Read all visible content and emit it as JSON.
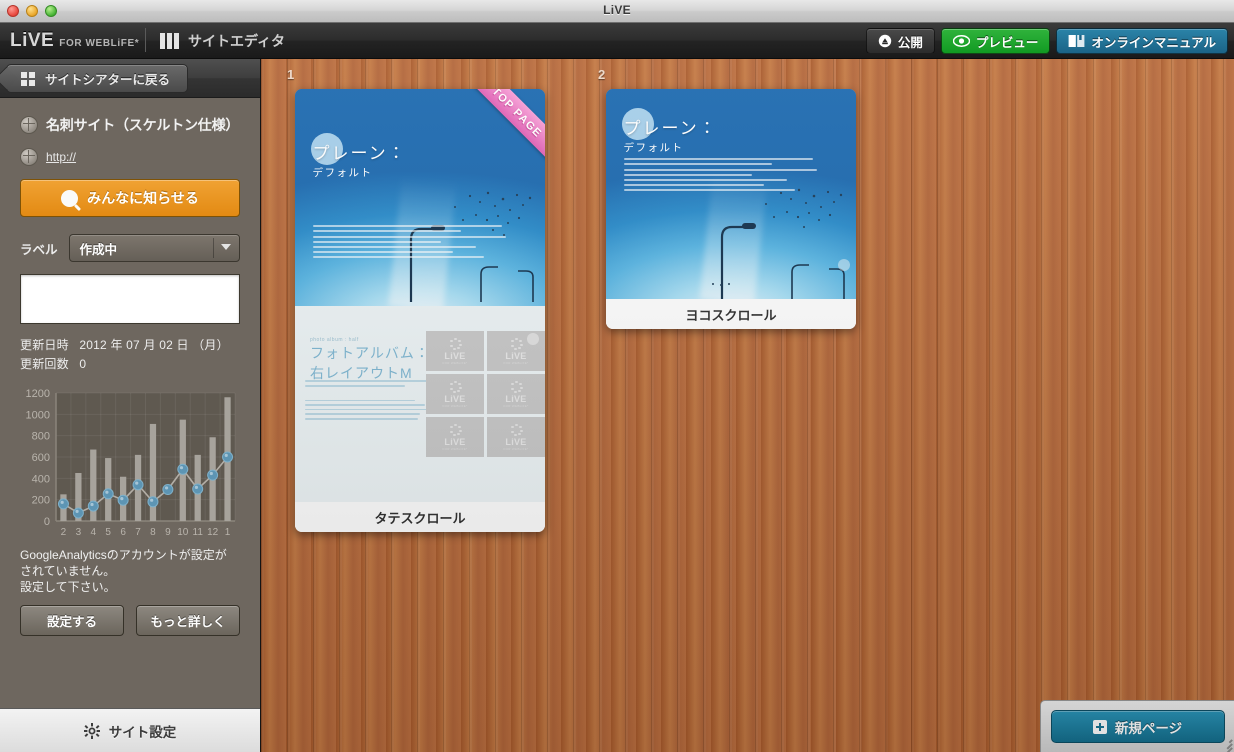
{
  "window": {
    "title": "LiVE"
  },
  "appbar": {
    "brand_live": "LiVE",
    "brand_for_weblife": "FOR WEBLiFE*",
    "section_title": "サイトエディタ",
    "buttons": {
      "publish": "公開",
      "preview": "プレビュー",
      "manual": "オンラインマニュアル"
    }
  },
  "sidebar": {
    "back_button": "サイトシアターに戻る",
    "site_name": "名刺サイト（スケルトン仕様）",
    "site_url": "http://",
    "share_button": "みんなに知らせる",
    "label_caption": "ラベル",
    "label_value": "作成中",
    "memo_value": "",
    "updated_at_label": "更新日時",
    "updated_at_value": "2012 年 07 月 02 日 （月）",
    "update_count_label": "更新回数",
    "update_count_value": "0",
    "ga_notice_line1": "GoogleAnalyticsのアカウントが設定が",
    "ga_notice_line2": "されていません。",
    "ga_notice_line3": "設定して下さい。",
    "ga_configure_button": "設定する",
    "ga_more_button": "もっと詳しく",
    "site_settings_button": "サイト設定"
  },
  "chart_data": {
    "type": "bar",
    "title": "",
    "xlabel": "",
    "ylabel": "",
    "ylim": [
      0,
      1200
    ],
    "yticks": [
      0,
      200,
      400,
      600,
      800,
      1000,
      1200
    ],
    "grid": true,
    "legend": "none",
    "categories": [
      "2",
      "3",
      "4",
      "5",
      "6",
      "7",
      "8",
      "9",
      "10",
      "11",
      "12",
      "1"
    ],
    "series": [
      {
        "name": "bars",
        "type": "bar",
        "values": [
          250,
          450,
          670,
          590,
          415,
          620,
          910,
          0,
          950,
          620,
          785,
          1160
        ]
      },
      {
        "name": "line",
        "type": "line",
        "values": [
          160,
          75,
          140,
          255,
          195,
          340,
          180,
          295,
          485,
          300,
          430,
          600
        ]
      }
    ],
    "colors": {
      "bar": "#a7a39c",
      "line": "#b3aea6",
      "marker": "#5d95b4",
      "plot_bg": "#5f5950",
      "axis_text": "#b9b4ac"
    }
  },
  "canvas": {
    "pages": [
      {
        "number": "1",
        "label": "タテスクロール",
        "ribbon": "TOP PAGE",
        "hero_title": "プレーン：",
        "hero_subtitle": "デフォルト",
        "album_kicker": "photo album : half",
        "album_title_line1": "フォトアルバム：",
        "album_title_line2": "右レイアウトM",
        "tile_label": "LiVE",
        "tile_sublabel": "FOR WEBLiFE*"
      },
      {
        "number": "2",
        "label": "ヨコスクロール",
        "ribbon": "",
        "hero_title": "プレーン：",
        "hero_subtitle": "デフォルト"
      }
    ],
    "new_page_button": "新規ページ"
  },
  "colors": {
    "accent_orange": "#e38a13",
    "accent_green": "#119a22",
    "accent_blue": "#1b6487",
    "ribbon_pink": "#e060b4",
    "wood": "#b06539",
    "sidebar": "#6e675f"
  }
}
